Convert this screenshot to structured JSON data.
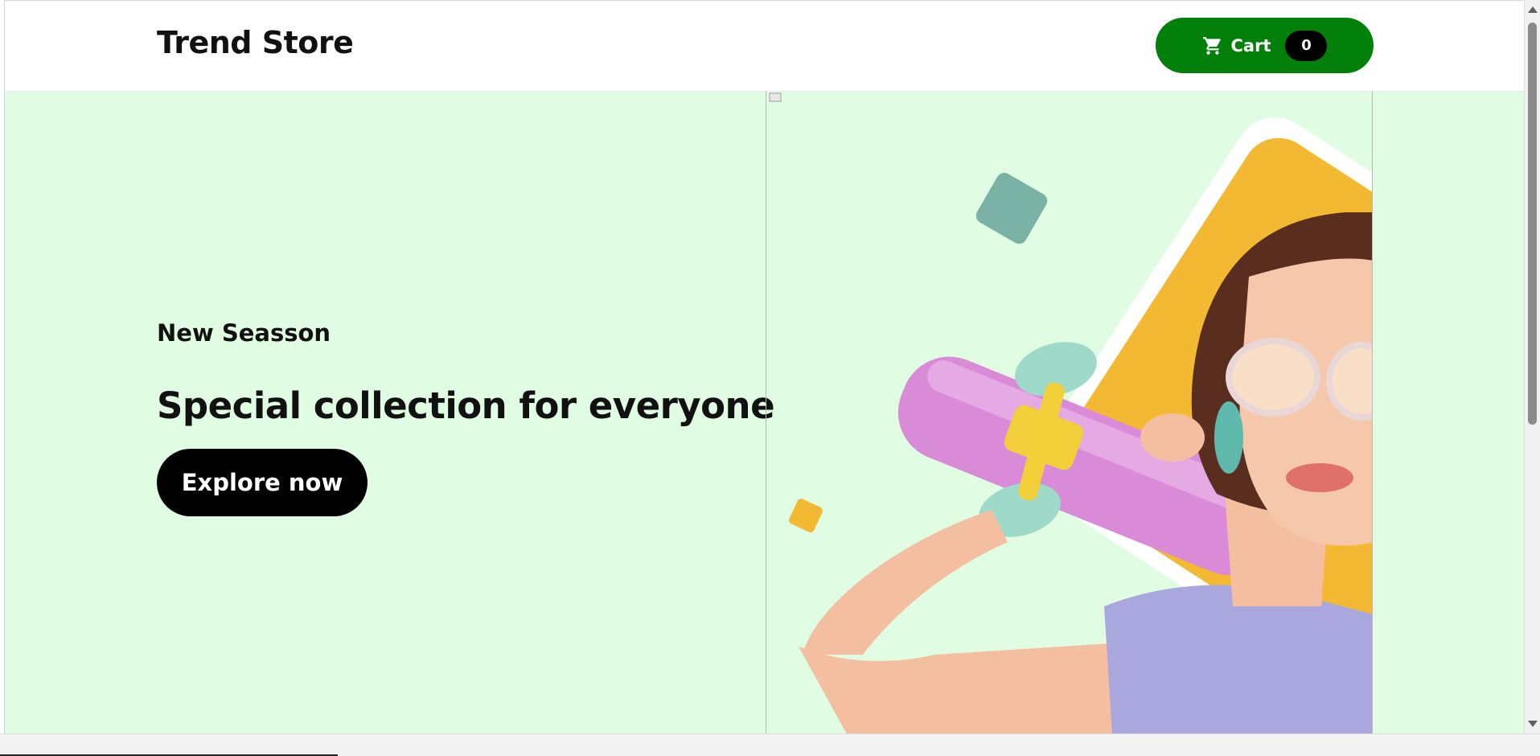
{
  "header": {
    "brand": "Trend Store",
    "cart_label": "Cart",
    "cart_count": "0"
  },
  "hero": {
    "subtitle": "New Seasson",
    "title": "Special collection for everyone",
    "cta_label": "Explore now"
  },
  "colors": {
    "accent_green": "#038009",
    "hero_background": "#e0fde3",
    "button_black": "#000000"
  },
  "icons": {
    "cart": "shopping-cart-icon"
  }
}
